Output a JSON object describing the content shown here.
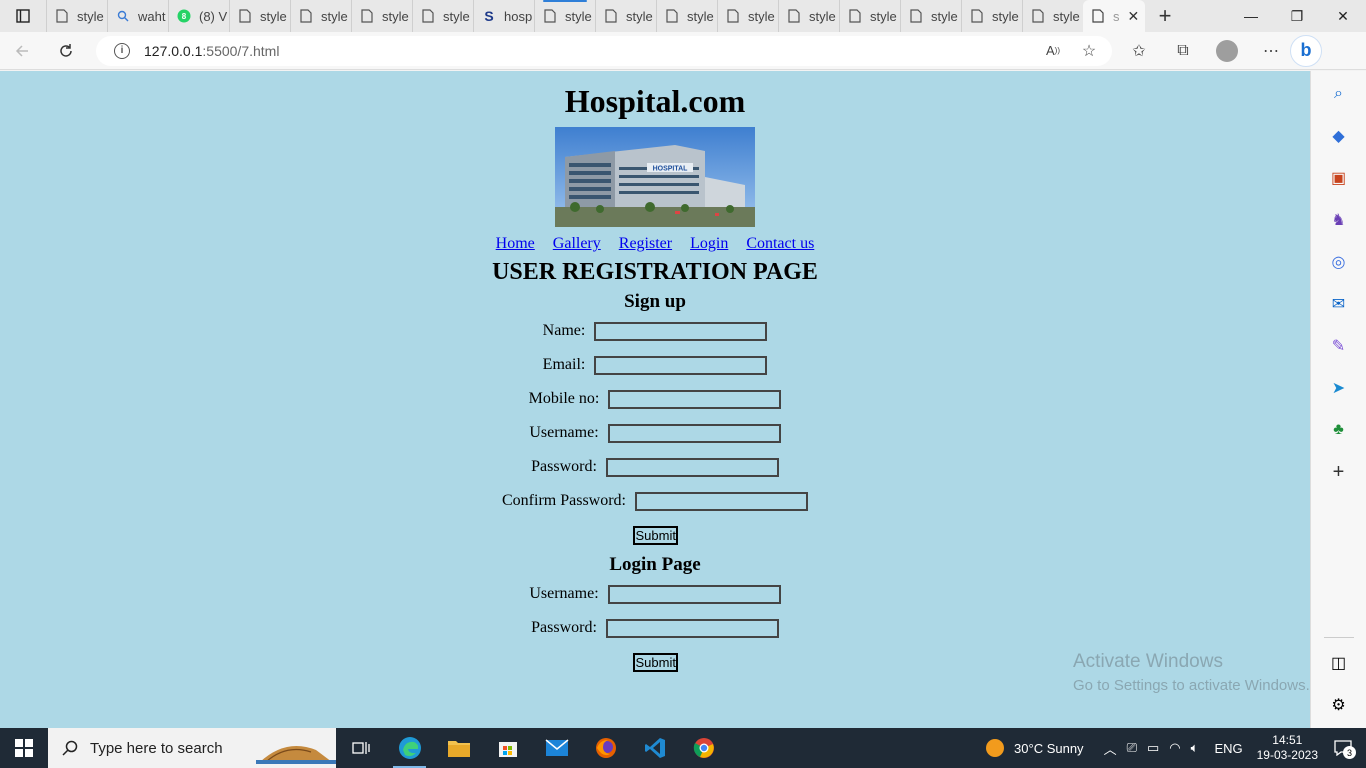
{
  "browser": {
    "tabs": [
      {
        "title": "style",
        "icon": "page-icon"
      },
      {
        "title": "waht",
        "icon": "search-icon"
      },
      {
        "title": "(8) V",
        "icon": "whatsapp-icon"
      },
      {
        "title": "style",
        "icon": "page-icon"
      },
      {
        "title": "style",
        "icon": "page-icon"
      },
      {
        "title": "style",
        "icon": "page-icon"
      },
      {
        "title": "style",
        "icon": "page-icon"
      },
      {
        "title": "hosp",
        "icon": "s-logo-icon"
      },
      {
        "title": "style",
        "icon": "page-icon"
      },
      {
        "title": "style",
        "icon": "page-icon"
      },
      {
        "title": "style",
        "icon": "page-icon"
      },
      {
        "title": "style",
        "icon": "page-icon"
      },
      {
        "title": "style",
        "icon": "page-icon"
      },
      {
        "title": "style",
        "icon": "page-icon"
      },
      {
        "title": "style",
        "icon": "page-icon"
      },
      {
        "title": "style",
        "icon": "page-icon"
      },
      {
        "title": "style",
        "icon": "page-icon"
      }
    ],
    "active_tab_title": "s",
    "url_host": "127.0.0.1",
    "url_path": ":5500/7.html"
  },
  "page": {
    "site_title": "Hospital.com",
    "hero_sign": "HOSPITAL",
    "nav": [
      "Home",
      "Gallery",
      "Register",
      "Login",
      "Contact us"
    ],
    "heading": "USER REGISTRATION PAGE",
    "signup_heading": "Sign up",
    "signup_fields": [
      "Name:",
      "Email:",
      "Mobile no:",
      "Username:",
      "Password:",
      "Confirm Password:"
    ],
    "signup_submit": "Submit",
    "login_heading": "Login Page",
    "login_fields": [
      "Username:",
      "Password:"
    ],
    "login_submit": "Submit"
  },
  "watermark": {
    "line1": "Activate Windows",
    "line2": "Go to Settings to activate Windows."
  },
  "taskbar": {
    "search_placeholder": "Type here to search",
    "weather": "30°C  Sunny",
    "language": "ENG",
    "time": "14:51",
    "date": "19-03-2023",
    "notifications": "3"
  },
  "colors": {
    "page_bg": "#add8e6",
    "link": "#0000ee",
    "taskbar_bg": "#1f2a36"
  }
}
